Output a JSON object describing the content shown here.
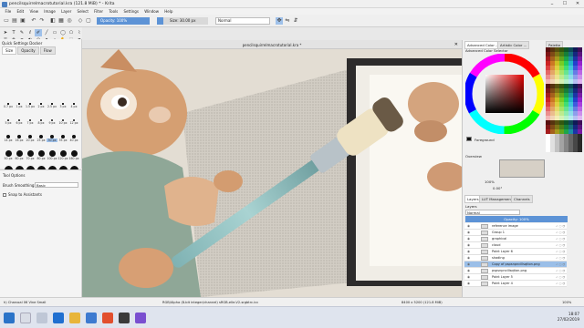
{
  "window": {
    "title": "pencilsquirrelmacrotutorial.kra (121.8 MiB) * - Krita",
    "minimize": "–",
    "maximize": "☐",
    "close": "✕"
  },
  "menu": [
    "File",
    "Edit",
    "View",
    "Image",
    "Layer",
    "Select",
    "Filter",
    "Tools",
    "Settings",
    "Window",
    "Help"
  ],
  "toolbar": {
    "opacity_label": "Opacity: 100%",
    "size_label": "Size: 30.00 px",
    "blend_mode": "Normal",
    "opacity_fill_fraction": 1.0,
    "size_fill_fraction": 0.12
  },
  "brush_dock": {
    "title": "Quick Settings Docker",
    "tabs": [
      "Size",
      "Opacity",
      "Flow"
    ],
    "sizes": [
      "0.7 px",
      "1 px",
      "1.5 px",
      "2 px",
      "2.5 px",
      "3 px",
      "4 px",
      "5 px",
      "6 px",
      "7 px",
      "8 px",
      "9 px",
      "10 px",
      "12 px",
      "14 px",
      "16 px",
      "20 px",
      "25 px",
      "30 px",
      "35 px",
      "40 px",
      "50 px",
      "60 px",
      "70 px",
      "80 px",
      "100 px",
      "120 px",
      "160 px",
      "200 px",
      "250 px",
      "300 px",
      "350 px",
      "400 px",
      "450 px",
      "500 px"
    ],
    "selected": "30 px"
  },
  "tool_options": {
    "title": "Tool Options",
    "smoothing_label": "Brush Smoothing:",
    "smoothing_value": "Basic",
    "snap_label": "Snap to Assistants"
  },
  "canvas": {
    "tab_title": "pencilsquirrelmacrotutorial.kra *"
  },
  "right_dock": {
    "color_tabs": [
      "Advanced Color ...",
      "Artistic Color ...",
      "Palette"
    ],
    "color_dock_title": "Advanced Color Selector",
    "overview_title": "Overview",
    "zoom_label": "100%",
    "rotation_label": "0.00°",
    "layer_tabs": [
      "Layers",
      "LUT Management",
      "Channels"
    ],
    "layers_title": "Layers",
    "blend_mode": "Normal",
    "opacity_label": "Opacity: 100%",
    "swatch_name": "Foreground",
    "layers": [
      {
        "name": "reference image",
        "selected": false
      },
      {
        "name": "Group 1",
        "selected": false
      },
      {
        "name": "graphical",
        "selected": false
      },
      {
        "name": "cloud",
        "selected": false
      },
      {
        "name": "Paint Layer 6",
        "selected": false
      },
      {
        "name": "shading",
        "selected": false
      },
      {
        "name": "Copy of pspsnpncillsqtion.png",
        "selected": true
      },
      {
        "name": "pspsnpncillsqtion.png",
        "selected": false
      },
      {
        "name": "Paint Layer 5",
        "selected": false
      },
      {
        "name": "Paint Layer 4",
        "selected": false
      }
    ]
  },
  "status": {
    "brush": "h) Charcoal 06 Vine Small",
    "colorspace": "RGB/Alpha (8-bit integer/channel)  sRGB-elle-V2-srgbtrc.icc",
    "size": "8400 x 5200 (121.8 MiB)",
    "zoom": "100%"
  },
  "taskbar": {
    "time": "18:07",
    "date": "27/02/2019"
  },
  "colors": {
    "accent": "#5d93d6",
    "selection": "#9bbfe8"
  }
}
